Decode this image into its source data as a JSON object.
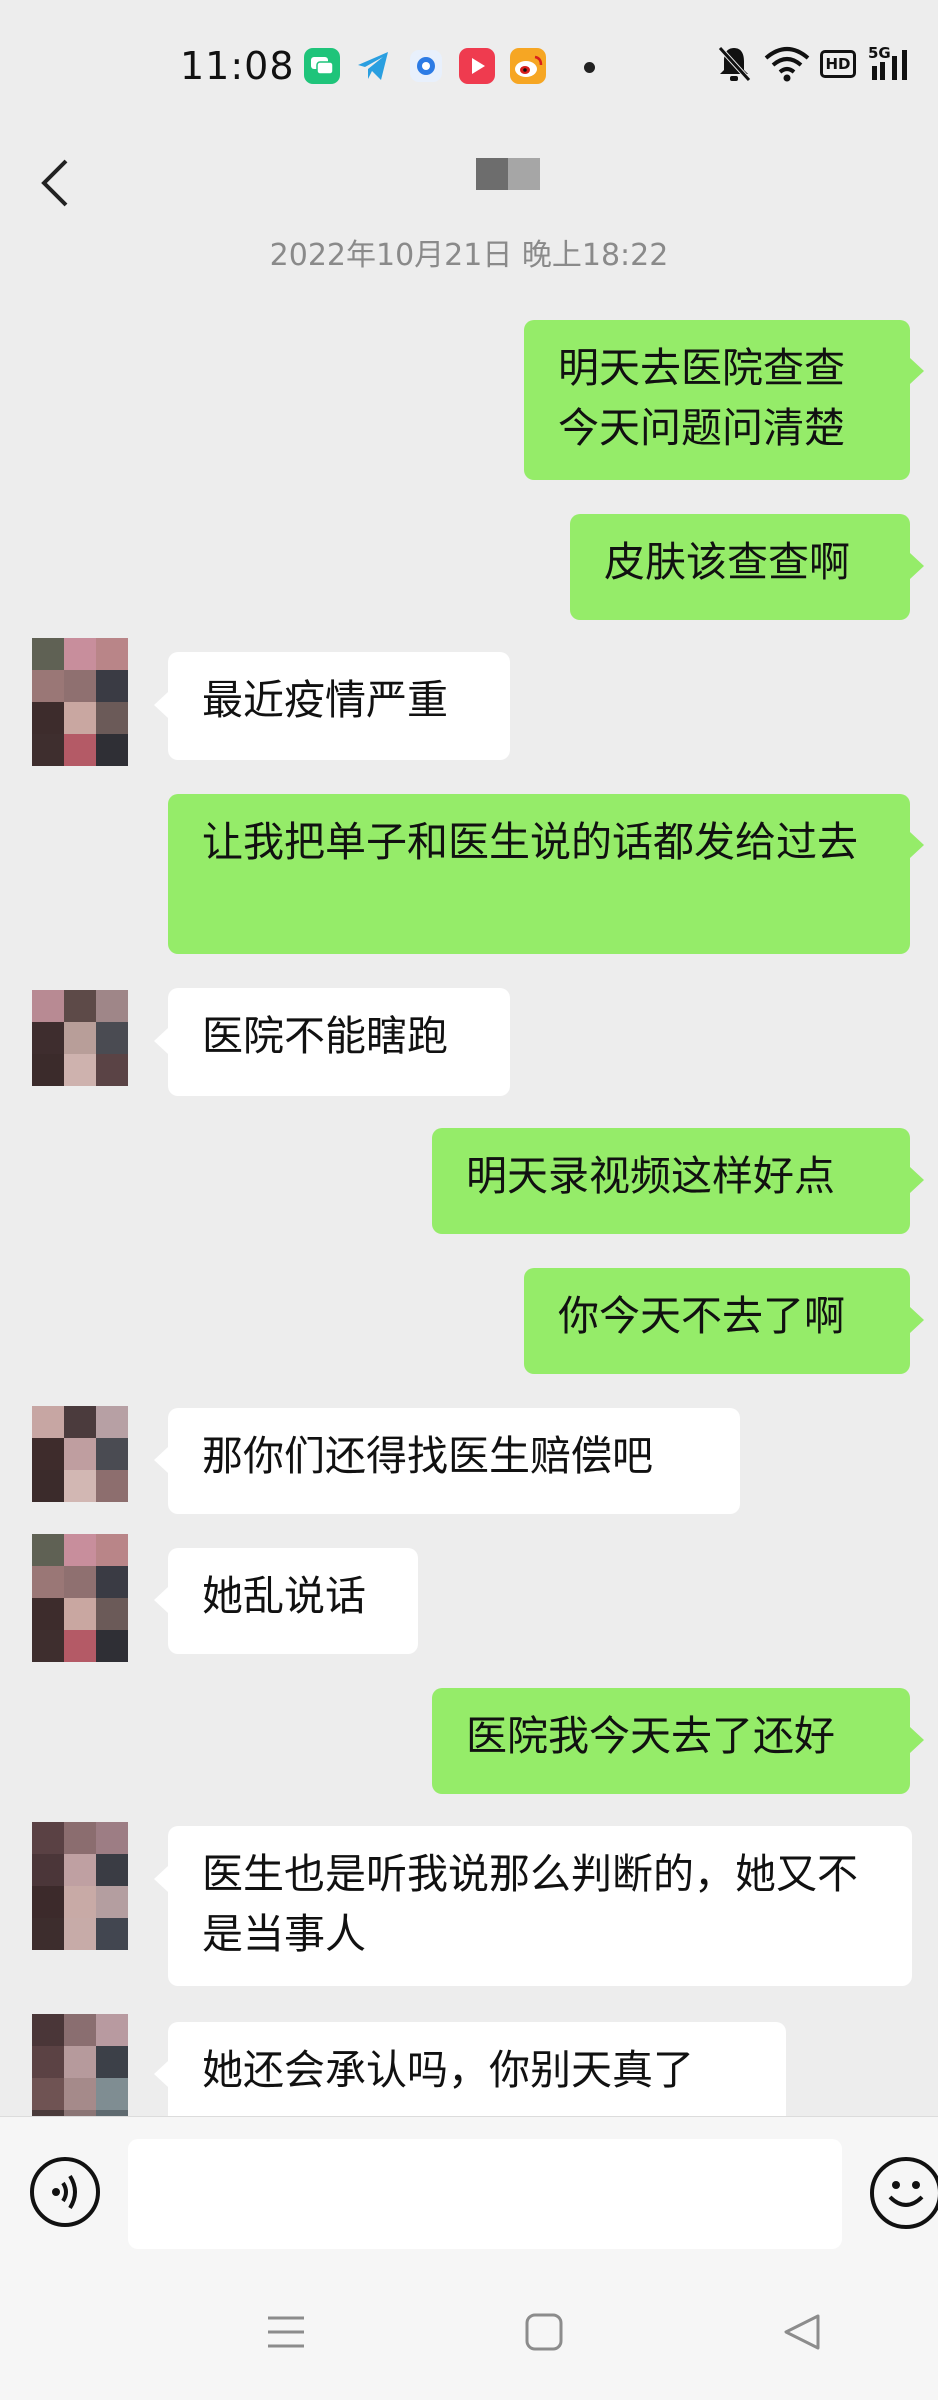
{
  "status_bar": {
    "time": "11:08",
    "app_icons": [
      {
        "name": "messaging-app-icon",
        "color": "#1fc47a"
      },
      {
        "name": "telegram-icon",
        "color": "#2a9fe0"
      },
      {
        "name": "circle-app-icon",
        "color": "#2c7be5"
      },
      {
        "name": "video-app-icon",
        "color": "#ef3b4f"
      },
      {
        "name": "weibo-icon",
        "color": "#f6a623"
      }
    ],
    "indicators": [
      "mute-bell-icon",
      "wifi-icon",
      "hd-icon",
      "5g-signal-icon"
    ],
    "hd_label": "HD",
    "network_label": "5G"
  },
  "header": {
    "back_icon": "back-chevron-icon",
    "title_color_left": "#6d6d6d",
    "title_color_right": "#a6a6a6"
  },
  "timestamp": "2022年10月21日 晚上18:22",
  "messages": [
    {
      "from": "me",
      "text": "明天去医院查查今天问题问清楚"
    },
    {
      "from": "me",
      "text": "皮肤该查查啊"
    },
    {
      "from": "them",
      "text": "最近疫情严重"
    },
    {
      "from": "me",
      "text": "让我把单子和医生说的话都发给过去"
    },
    {
      "from": "them",
      "text": "医院不能瞎跑"
    },
    {
      "from": "me",
      "text": "明天录视频这样好点"
    },
    {
      "from": "me",
      "text": "你今天不去了啊"
    },
    {
      "from": "them",
      "text": "那你们还得找医生赔偿吧"
    },
    {
      "from": "them",
      "text": "她乱说话"
    },
    {
      "from": "me",
      "text": "医院我今天去了还好"
    },
    {
      "from": "them",
      "text": "医生也是听我说那么判断的，她又不是当事人"
    },
    {
      "from": "them",
      "text": "她还会承认吗，你别天真了"
    }
  ],
  "input_bar": {
    "voice_icon": "voice-input-icon",
    "input_value": "",
    "emoji_icon": "emoji-icon"
  },
  "system_nav": [
    "menu-icon",
    "home-square-icon",
    "back-triangle-icon"
  ],
  "colors": {
    "background": "#ededed",
    "my_bubble": "#95ec69",
    "their_bubble": "#ffffff",
    "timestamp_text": "#8a8a8a"
  }
}
